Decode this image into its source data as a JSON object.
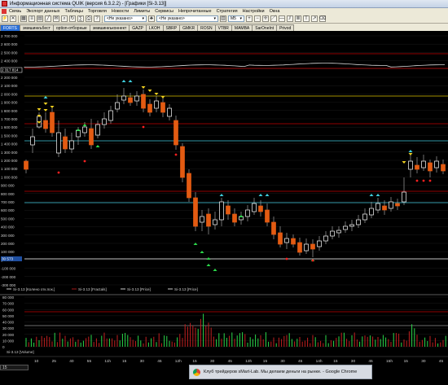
{
  "window": {
    "title": "Информационная система QUIK (версия 6.3.2.2) - [Графики [Si-3.13]]"
  },
  "menu": [
    "Связь",
    "Экспорт данных",
    "Таблицы",
    "Торговля",
    "Новости",
    "Лимиты",
    "Сервисы",
    "Непрочитанные",
    "Стратегия",
    "Настройки",
    "Окна"
  ],
  "toolbar": {
    "account_select": "<Не указано>",
    "instrument_select": "<Не указано>",
    "interval_select": "M5"
  },
  "tabs": [
    "FORTS",
    "эмишинкъбест",
    "option-отборные",
    "эмишинкъконнект",
    "GAZP",
    "LKOH",
    "SBRP",
    "GMKR",
    "ROSN",
    "VTBR",
    "MAMBA",
    "SarOneInt",
    "Privod"
  ],
  "chart_data": [
    {
      "type": "candlestick",
      "y_ticks": [
        "2 700 000",
        "2 600 000",
        "2 500 000",
        "2 400 000",
        "2 300 000",
        "2 200 000",
        "2 100 000",
        "2 000 000",
        "1 900 000",
        "1 800 000",
        "1 700 000",
        "1 600 000",
        "1 500 000",
        "1 400 000",
        "1 300 000",
        "1 200 000",
        "1 100 000",
        "1 000 000",
        "900 000",
        "800 000",
        "700 000",
        "600 000",
        "500 000",
        "400 000",
        "300 000",
        "200 000",
        "100 000",
        "0",
        "-100 000",
        "-200 000",
        "-300 000"
      ],
      "price_labels": [
        "2 317 814",
        "30 573"
      ],
      "legend": [
        "Si-3.13 [Колено отк.пок.]",
        "Si-3.13 [Fractals]",
        "Si-3.13 [Price]",
        "Si-3.13 [Price]"
      ]
    },
    {
      "type": "bar",
      "y_ticks": [
        "80 000",
        "70 000",
        "60 000",
        "50 000",
        "40 000",
        "30 000",
        "20 000",
        "10 000",
        "0"
      ],
      "legend": [
        "Si-3.13 [Volume]"
      ]
    }
  ],
  "x_ticks": [
    "10",
    "25",
    "40",
    "55",
    "11h",
    "15",
    "30",
    "45",
    "12h",
    "15",
    "30",
    "45",
    "13h",
    "15",
    "30",
    "45",
    "14h",
    "15",
    "30",
    "45",
    "15h",
    "15",
    "30",
    "45"
  ],
  "status": {
    "range": "15"
  },
  "taskbar": {
    "chrome_tab": "Клуб трейдеров sMart-Lab. Мы делаем деньги на рынке. - Google Chrome"
  },
  "colors": {
    "up": "#ffffff",
    "down": "#e35b12",
    "grid": "#1a1a1a",
    "accent_line": "#c00000",
    "cyan_line": "#3fc5d9",
    "yellow_line": "#d8c000"
  }
}
